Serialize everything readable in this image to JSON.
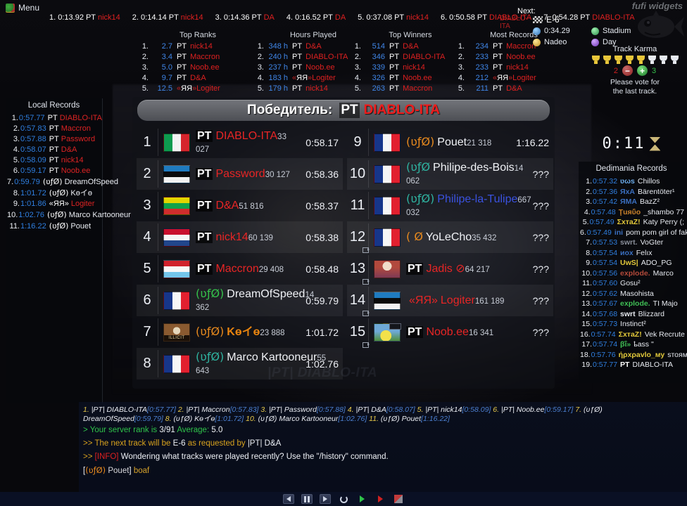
{
  "window": {
    "menu_label": "Menu",
    "watermark": "fufi widgets",
    "bg_watermark": "|PT| DIABLO-ITA"
  },
  "ticker": {
    "items": [
      {
        "idx": "1.",
        "time": "0:13.92",
        "tag": "PT",
        "player": "nick14"
      },
      {
        "idx": "2.",
        "time": "0:14.14",
        "tag": "PT",
        "player": "nick14"
      },
      {
        "idx": "3.",
        "time": "0:14.36",
        "tag": "PT",
        "player": "DA"
      },
      {
        "idx": "4.",
        "time": "0:16.52",
        "tag": "PT",
        "player": "DA"
      },
      {
        "idx": "5.",
        "time": "0:37.08",
        "tag": "PT",
        "player": "nick14"
      },
      {
        "idx": "6.",
        "time": "0:50.58",
        "tag": "PT",
        "player": "DIABLO-ITA"
      },
      {
        "idx": "7.",
        "time": "0:54.28",
        "tag": "PT",
        "player": "DIABLO-ITA"
      }
    ]
  },
  "widgets": {
    "top_ranks": {
      "title": "Top Ranks",
      "rows": [
        {
          "idx": "1.",
          "value": "2.7",
          "tag": "PT",
          "name": "nick14"
        },
        {
          "idx": "2.",
          "value": "3.4",
          "tag": "PT",
          "name": "Maccron"
        },
        {
          "idx": "3.",
          "value": "5.0",
          "tag": "PT",
          "name": "Noob.ee"
        },
        {
          "idx": "4.",
          "value": "9.7",
          "tag": "PT",
          "name": "D&A"
        },
        {
          "idx": "5.",
          "value": "12.5",
          "tag": "«ЯЯ»",
          "name": "Logiter"
        }
      ]
    },
    "hours_played": {
      "title": "Hours Played",
      "rows": [
        {
          "idx": "1.",
          "value": "348 h",
          "tag": "PT",
          "name": "D&A"
        },
        {
          "idx": "2.",
          "value": "240 h",
          "tag": "PT",
          "name": "DIABLO-ITA"
        },
        {
          "idx": "3.",
          "value": "237 h",
          "tag": "PT",
          "name": "Noob.ee"
        },
        {
          "idx": "4.",
          "value": "183 h",
          "tag": "«ЯЯ»",
          "name": "Logiter"
        },
        {
          "idx": "5.",
          "value": "179 h",
          "tag": "PT",
          "name": "nick14"
        }
      ]
    },
    "top_winners": {
      "title": "Top Winners",
      "rows": [
        {
          "idx": "1.",
          "value": "514",
          "tag": "PT",
          "name": "D&A"
        },
        {
          "idx": "2.",
          "value": "346",
          "tag": "PT",
          "name": "DIABLO-ITA"
        },
        {
          "idx": "3.",
          "value": "339",
          "tag": "PT",
          "name": "nick14"
        },
        {
          "idx": "4.",
          "value": "326",
          "tag": "PT",
          "name": "Noob.ee"
        },
        {
          "idx": "5.",
          "value": "263",
          "tag": "PT",
          "name": "Maccron"
        }
      ]
    },
    "most_records": {
      "title": "Most Records",
      "rows": [
        {
          "idx": "1.",
          "value": "234",
          "tag": "PT",
          "name": "Maccron"
        },
        {
          "idx": "2.",
          "value": "233",
          "tag": "PT",
          "name": "Noob.ee"
        },
        {
          "idx": "3.",
          "value": "233",
          "tag": "PT",
          "name": "nick14"
        },
        {
          "idx": "4.",
          "value": "212",
          "tag": "«ЯЯ»",
          "name": "Logiter"
        },
        {
          "idx": "5.",
          "value": "211",
          "tag": "PT",
          "name": "D&A"
        }
      ]
    }
  },
  "next_track": {
    "label": "Next:",
    "prev_name": "DIABLO-ITA",
    "name": "E-6",
    "time": "0:34.29",
    "author": "Nadeo",
    "environment": "Stadium",
    "mood": "Day"
  },
  "track_karma": {
    "title": "Track Karma",
    "gold_cups": 5,
    "total_cups": 8,
    "negative": "2",
    "positive": "3",
    "vote_text_line1": "Please vote for",
    "vote_text_line2": "the last track."
  },
  "timer": {
    "value": "0:11"
  },
  "local_records": {
    "title": "Local Records",
    "rows": [
      {
        "idx": "1.",
        "time": "0:57.77",
        "clan": "PT",
        "clan_style": "tag",
        "name": "DIABLO-ITA"
      },
      {
        "idx": "2.",
        "time": "0:57.83",
        "clan": "PT",
        "clan_style": "tag",
        "name": "Maccron"
      },
      {
        "idx": "3.",
        "time": "0:57.88",
        "clan": "PT",
        "clan_style": "tag",
        "name": "Password"
      },
      {
        "idx": "4.",
        "time": "0:58.07",
        "clan": "PT",
        "clan_style": "tag",
        "name": "D&A"
      },
      {
        "idx": "5.",
        "time": "0:58.09",
        "clan": "PT",
        "clan_style": "tag",
        "name": "nick14"
      },
      {
        "idx": "6.",
        "time": "0:59.17",
        "clan": "PT",
        "clan_style": "tag",
        "name": "Noob.ee"
      },
      {
        "idx": "7.",
        "time": "0:59.79",
        "clan": "(ʋƒØ)",
        "clan_style": "ufo-g",
        "name": "DreamOfSpeed",
        "white": true
      },
      {
        "idx": "8.",
        "time": "1:01.72",
        "clan": "(ʋƒØ)",
        "clan_style": "ufo-o",
        "name": "Kөイө",
        "white": true
      },
      {
        "idx": "9.",
        "time": "1:01.86",
        "clan": "«ЯЯ»",
        "clan_style": "tag",
        "name": "Logiter"
      },
      {
        "idx": "10.",
        "time": "1:02.76",
        "clan": "(ʋƒØ)",
        "clan_style": "ufo",
        "name": "Marco Kartooneur",
        "white": true
      },
      {
        "idx": "11.",
        "time": "1:16.22",
        "clan": "(ʋƒØ)",
        "clan_style": "ufo-o",
        "name": "Pouet",
        "white": true
      }
    ]
  },
  "dedimania": {
    "title": "Dedimania Records",
    "rows": [
      {
        "idx": "1.",
        "time": "0:57.32",
        "clan": "ʋωs",
        "name": "Chillos"
      },
      {
        "idx": "2.",
        "time": "0:57.36",
        "clan": "ЯxA",
        "name": "Bärentöter¹"
      },
      {
        "idx": "3.",
        "time": "0:57.42",
        "clan": "ЯMA",
        "name": "BazZ²"
      },
      {
        "idx": "4.",
        "time": "0:57.48",
        "clan": "Ţuяΰo",
        "name": "_shambo 77"
      },
      {
        "idx": "5.",
        "time": "0:57.49",
        "clan": "ΣxтaZ!",
        "name": "Katy Perry (;"
      },
      {
        "idx": "6.",
        "time": "0:57.49",
        "clan": "ini",
        "name": "pom pom girl of fake"
      },
      {
        "idx": "7.",
        "time": "0:57.53",
        "clan": "swrt.",
        "name": "VoGter"
      },
      {
        "idx": "8.",
        "time": "0:57.54",
        "clan": "иox",
        "name": "Felıx"
      },
      {
        "idx": "9.",
        "time": "0:57.54",
        "clan": "UwS|",
        "name": "ADO_PG"
      },
      {
        "idx": "10.",
        "time": "0:57.56",
        "clan": "explode.",
        "name": "Marco"
      },
      {
        "idx": "11.",
        "time": "0:57.60",
        "clan": "",
        "name": "Gosu²"
      },
      {
        "idx": "12.",
        "time": "0:57.62",
        "clan": "",
        "name": "Masohista"
      },
      {
        "idx": "13.",
        "time": "0:57.67",
        "clan": "explode.",
        "name": "TI Majo"
      },
      {
        "idx": "14.",
        "time": "0:57.68",
        "clan": "swrt",
        "name": "Blizzard"
      },
      {
        "idx": "15.",
        "time": "0:57.73",
        "clan": "",
        "name": "Instinct²"
      },
      {
        "idx": "16.",
        "time": "0:57.74",
        "clan": "ΣxтaZ!",
        "name": "Vek Recrute"
      },
      {
        "idx": "17.",
        "time": "0:57.74",
        "clan": "βΐ»",
        "name": "ҍass \""
      },
      {
        "idx": "18.",
        "time": "0:57.76",
        "clan": "ήρxρavlo_му",
        "name": "ѕтоямʔ"
      },
      {
        "idx": "19.",
        "time": "0:57.77",
        "clan": "PT",
        "name": "DIABLO-ITA"
      }
    ]
  },
  "scoreboard": {
    "header_title": "Победитель:",
    "header_tag": "PT",
    "header_winner": "DIABLO-ITA",
    "left": [
      {
        "pos": "1",
        "flag": "fl-it",
        "tag": "PT",
        "tag_style": "ptag",
        "name": "DIABLO-ITA",
        "name_color": "red",
        "score": "33 027",
        "time": "0:58.17",
        "alt": false,
        "cam": false
      },
      {
        "pos": "2",
        "flag": "fl-ee",
        "tag": "PT",
        "tag_style": "ptag",
        "name": "Password",
        "name_color": "red",
        "score": "30 127",
        "time": "0:58.36",
        "alt": true,
        "cam": false
      },
      {
        "pos": "3",
        "flag": "fl-lt",
        "tag": "PT",
        "tag_style": "ptag",
        "name": "D&A",
        "name_color": "red",
        "score": "51 816",
        "time": "0:58.37",
        "alt": false,
        "cam": false
      },
      {
        "pos": "4",
        "flag": "fl-nl",
        "tag": "PT",
        "tag_style": "ptag",
        "name": "nick14",
        "name_color": "red",
        "score": "60 139",
        "time": "0:58.38",
        "alt": true,
        "cam": false
      },
      {
        "pos": "5",
        "flag": "fl-lu",
        "tag": "PT",
        "tag_style": "ptag",
        "name": "Maccron",
        "name_color": "red",
        "score": "29 408",
        "time": "0:58.48",
        "alt": false,
        "cam": false
      },
      {
        "pos": "6",
        "flag": "fl-fr",
        "tag": "(ʋƒØ)",
        "tag_style": "ufo-g",
        "name": "DreamOfSpeed",
        "name_color": "white",
        "score": "14 362",
        "time": "0:59.79",
        "alt": true,
        "cam": false
      },
      {
        "pos": "7",
        "flag": "av-illicit",
        "tag": "(ʋƒØ)",
        "tag_style": "ufo-o",
        "name": "Kөイө",
        "name_color": "orange",
        "score": "23 888",
        "time": "1:01.72",
        "alt": false,
        "cam": false,
        "badge": "ILLICIT"
      },
      {
        "pos": "8",
        "flag": "fl-fr",
        "tag": "(ʋƒØ)",
        "tag_style": "ufo",
        "name": "Marco Kartooneur",
        "name_color": "white",
        "score": "55 643",
        "time": "1:02.76",
        "alt": true,
        "cam": false
      }
    ],
    "right": [
      {
        "pos": "9",
        "flag": "fl-fr",
        "tag": "(ʋƒØ)",
        "tag_style": "ufo-o",
        "name": "Pouet",
        "name_color": "white",
        "score": "21 318",
        "time": "1:16.22",
        "alt": false,
        "cam": false
      },
      {
        "pos": "10",
        "flag": "fl-fr",
        "tag": "(ʋƒØ",
        "tag_style": "ufo",
        "name": "Philipe-des-Bois",
        "name_color": "white",
        "score": "14 062",
        "time": "???",
        "alt": true,
        "cam": false
      },
      {
        "pos": "11",
        "flag": "fl-fr",
        "tag": "(ʋƒØ)",
        "tag_style": "ufo",
        "name": "Philipe-la-Tulipe",
        "name_color": "blue",
        "score": "667 032",
        "time": "???",
        "alt": false,
        "cam": false
      },
      {
        "pos": "12",
        "flag": "fl-fr",
        "tag": "( Ø",
        "tag_style": "ufo-o",
        "name": "YoLeCho",
        "name_color": "white",
        "score": "35 432",
        "time": "???",
        "alt": true,
        "cam": true
      },
      {
        "pos": "13",
        "flag": "av-jadis",
        "tag": "PT",
        "tag_style": "ptag",
        "name": "Jadis ⊘",
        "name_color": "red",
        "score": "64 217",
        "time": "???",
        "alt": false,
        "cam": true
      },
      {
        "pos": "14",
        "flag": "fl-ee",
        "tag": "«ЯЯ»",
        "tag_style": "ptag-plain",
        "name": "Logiter",
        "name_color": "red",
        "score": "161 189",
        "time": "???",
        "alt": true,
        "cam": true
      },
      {
        "pos": "15",
        "flag": "av-noob",
        "tag": "PT",
        "tag_style": "ptag",
        "name": "Noob.ee",
        "name_color": "red",
        "score": "16 341",
        "time": "???",
        "alt": false,
        "cam": true
      }
    ]
  },
  "chat": {
    "results_line": [
      {
        "i": "1.",
        "p": "|PT| DIABLO-ITA",
        "t": "[0:57.77]"
      },
      {
        "i": "2.",
        "p": "|PT| Maccron",
        "t": "[0:57.83]"
      },
      {
        "i": "3.",
        "p": "|PT| Password",
        "t": "[0:57.88]"
      },
      {
        "i": "4.",
        "p": "|PT| D&A",
        "t": "[0:58.07]"
      },
      {
        "i": "5.",
        "p": "|PT| nick14",
        "t": "[0:58.09]"
      },
      {
        "i": "6.",
        "p": "|PT| Noob.ee",
        "t": "[0:59.17]"
      },
      {
        "i": "7.",
        "p": "(ʋƒØ) DreamOfSpeed",
        "t": "[0:59.79]"
      },
      {
        "i": "8.",
        "p": "(ʋƒØ) Kөイө",
        "t": "[1:01.72]"
      },
      {
        "i": "10.",
        "p": "(ʋƒØ) Marco Kartooneur",
        "t": "[1:02.76]"
      },
      {
        "i": "11.",
        "p": "(ʋƒØ) Pouet",
        "t": "[1:16.22]"
      }
    ],
    "rank_line": {
      "chevron": ">",
      "text": "Your server rank is",
      "rank": "3/91",
      "avg_label": "Average:",
      "avg": "5.0"
    },
    "next_line": {
      "chevron": ">>",
      "pre": "The next track will be",
      "track": "E-6",
      "mid": "as requested by",
      "player": "|PT| D&A"
    },
    "info_line": {
      "chevron": ">>",
      "tag": "[INFO]",
      "text": "Wondering what tracks were played recently?  Use the \"/history\" command."
    },
    "msg_line": {
      "clan": "(ʋƒØ)",
      "user": "Pouet",
      "text": "boaf"
    }
  },
  "toolbar": {
    "buttons": [
      "prev-icon",
      "pause-icon",
      "next-icon",
      "replay-icon",
      "play-green-icon",
      "play-red-icon",
      "flag-icon"
    ]
  }
}
